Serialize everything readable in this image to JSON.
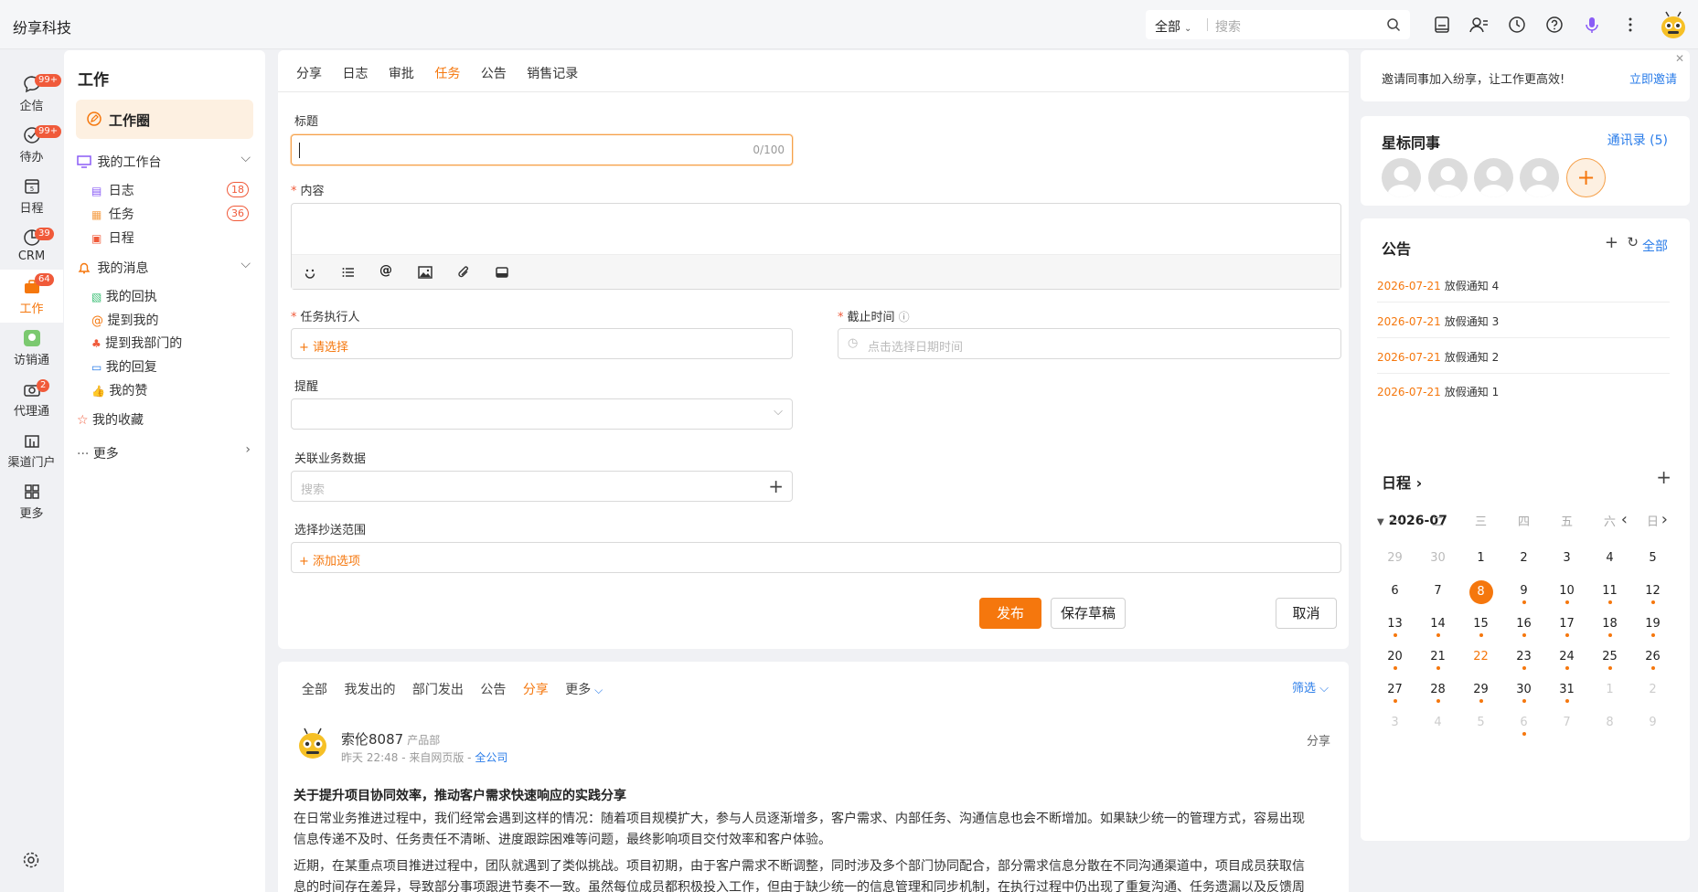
{
  "app": {
    "title": "纷享科技"
  },
  "search": {
    "scope": "全部",
    "placeholder": "搜索"
  },
  "leftnav": [
    {
      "label": "企信",
      "badge": "99+",
      "icon": "chat-icon"
    },
    {
      "label": "待办",
      "badge": "99+",
      "icon": "todo-icon"
    },
    {
      "label": "日程",
      "badge": "",
      "icon": "calendar-icon"
    },
    {
      "label": "CRM",
      "badge": "39",
      "icon": "crm-icon"
    },
    {
      "label": "工作",
      "badge": "64",
      "icon": "briefcase-icon",
      "active": true
    },
    {
      "label": "访销通",
      "badge": "",
      "icon": "visit-icon"
    },
    {
      "label": "代理通",
      "badge": "2",
      "icon": "agent-icon"
    },
    {
      "label": "渠道门户",
      "badge": "",
      "icon": "channel-icon"
    },
    {
      "label": "更多",
      "badge": "",
      "icon": "grid-icon"
    }
  ],
  "sidepanel": {
    "title": "工作",
    "circle": "工作圈",
    "workbench": "我的工作台",
    "workbench_items": [
      {
        "label": "日志",
        "count": "18"
      },
      {
        "label": "任务",
        "count": "36"
      },
      {
        "label": "日程",
        "count": ""
      }
    ],
    "messages": "我的消息",
    "message_items": [
      "我的回执",
      "提到我的",
      "提到我部门的",
      "我的回复",
      "我的赞"
    ],
    "favorites": "我的收藏",
    "more": "更多"
  },
  "composer": {
    "tabs": [
      "分享",
      "日志",
      "审批",
      "任务",
      "公告",
      "销售记录"
    ],
    "active_tab": "任务",
    "title_label": "标题",
    "title_counter": "0/100",
    "content_label": "内容",
    "executor_label": "任务执行人",
    "executor_placeholder": "+ 请选择",
    "deadline_label": "截止时间",
    "deadline_placeholder": "点击选择日期时间",
    "remind_label": "提醒",
    "related_label": "关联业务数据",
    "related_placeholder": "搜索",
    "cc_label": "选择抄送范围",
    "cc_placeholder": "+ 添加选项",
    "publish": "发布",
    "save_draft": "保存草稿",
    "cancel": "取消"
  },
  "feed": {
    "tabs": [
      "全部",
      "我发出的",
      "部门发出",
      "公告",
      "分享"
    ],
    "active_tab": "分享",
    "more": "更多",
    "filter": "筛选",
    "post": {
      "author": "索伦8087",
      "dept": "产品部",
      "time": "昨天 22:48 - 来自网页版 - ",
      "scope": "全公司",
      "type": "分享",
      "title": "关于提升项目协同效率，推动客户需求快速响应的实践分享",
      "para1_line1": "在日常业务推进过程中，我们经常会遇到这样的情况：随着项目规模扩大，参与人员逐渐增多，客户需求、内部任务、沟通信息也会不断增加。如果缺少统一的管理方式，容易出现",
      "para1_line2": "信息传递不及时、任务责任不清晰、进度跟踪困难等问题，最终影响项目交付效率和客户体验。",
      "para2_line1": "近期，在某重点项目推进过程中，团队就遇到了类似挑战。项目初期，由于客户需求不断调整，同时涉及多个部门协同配合，部分需求信息分散在不同沟通渠道中，项目成员获取信",
      "para2_line2": "息的时间存在差异，导致部分事项跟进节奏不一致。虽然每位成员都积极投入工作，但由于缺少统一的信息管理和同步机制，在执行过程中仍出现了重复沟通、任务遗漏以及反馈周"
    }
  },
  "right": {
    "invite_text": "邀请同事加入纷享，让工作更高效!",
    "invite_link": "立即邀请",
    "starred_title": "星标同事",
    "contacts_link": "通讯录 (5)",
    "notice_title": "公告",
    "notice_all": "全部",
    "notices": [
      {
        "date": "2026-07-21",
        "title": "放假通知 4"
      },
      {
        "date": "2026-07-21",
        "title": "放假通知 3"
      },
      {
        "date": "2026-07-21",
        "title": "放假通知 2"
      },
      {
        "date": "2026-07-21",
        "title": "放假通知 1"
      }
    ],
    "schedule_title": "日程",
    "month": "2026-07",
    "weekdays": [
      "一",
      "二",
      "三",
      "四",
      "五",
      "六",
      "日"
    ],
    "days": [
      [
        "29",
        "30",
        "1",
        "2",
        "3",
        "4",
        "5"
      ],
      [
        "6",
        "7",
        "8",
        "9",
        "10",
        "11",
        "12"
      ],
      [
        "13",
        "14",
        "15",
        "16",
        "17",
        "18",
        "19"
      ],
      [
        "20",
        "21",
        "22",
        "23",
        "24",
        "25",
        "26"
      ],
      [
        "27",
        "28",
        "29",
        "30",
        "31",
        "1",
        "2"
      ],
      [
        "3",
        "4",
        "5",
        "6",
        "7",
        "8",
        "9"
      ]
    ],
    "today": "8",
    "accent": "#f5770d"
  }
}
